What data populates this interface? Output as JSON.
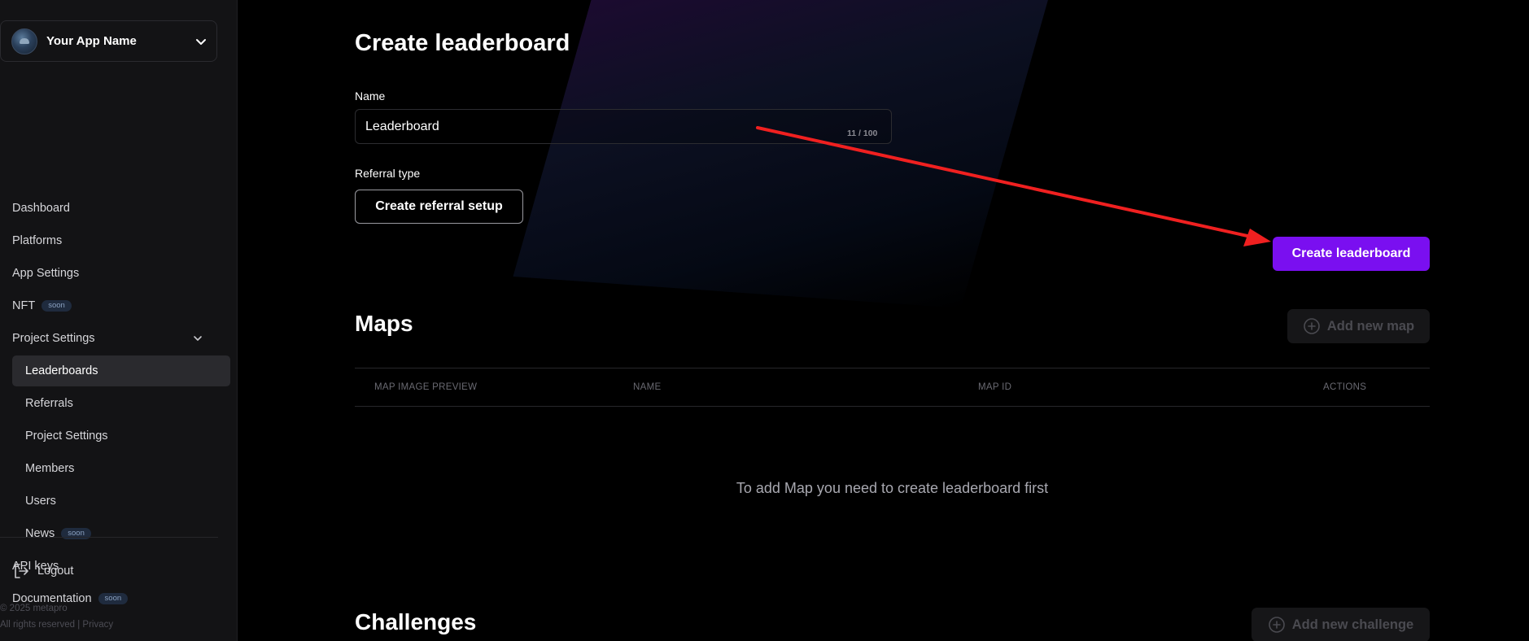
{
  "app": {
    "name": "Your App Name"
  },
  "sidebar": {
    "items": [
      {
        "label": "Dashboard"
      },
      {
        "label": "Platforms"
      },
      {
        "label": "App Settings"
      },
      {
        "label": "NFT",
        "badge": "soon"
      },
      {
        "label": "Project Settings"
      },
      {
        "label": "Leaderboards"
      },
      {
        "label": "Referrals"
      },
      {
        "label": "Project Settings"
      },
      {
        "label": "Members"
      },
      {
        "label": "Users"
      },
      {
        "label": "News",
        "badge": "soon"
      },
      {
        "label": "API keys"
      },
      {
        "label": "Documentation",
        "badge": "soon"
      }
    ],
    "logout": "Logout",
    "footer_copyright": "© 2025 metapro",
    "footer_rights": "All rights reserved |",
    "footer_privacy": "Privacy"
  },
  "form": {
    "title": "Create leaderboard",
    "name_label": "Name",
    "name_value": "Leaderboard",
    "name_counter": "11 / 100",
    "referral_label": "Referral type",
    "referral_button": "Create referral setup",
    "submit_button": "Create leaderboard"
  },
  "maps": {
    "title": "Maps",
    "add_button": "Add new map",
    "columns": [
      "MAP IMAGE PREVIEW",
      "NAME",
      "MAP ID",
      "ACTIONS"
    ],
    "empty_message": "To add Map you need to create leaderboard first"
  },
  "challenges": {
    "title": "Challenges",
    "add_button": "Add new challenge"
  },
  "colors": {
    "accent": "#7a0ff0",
    "annotation_arrow": "#f02020"
  }
}
